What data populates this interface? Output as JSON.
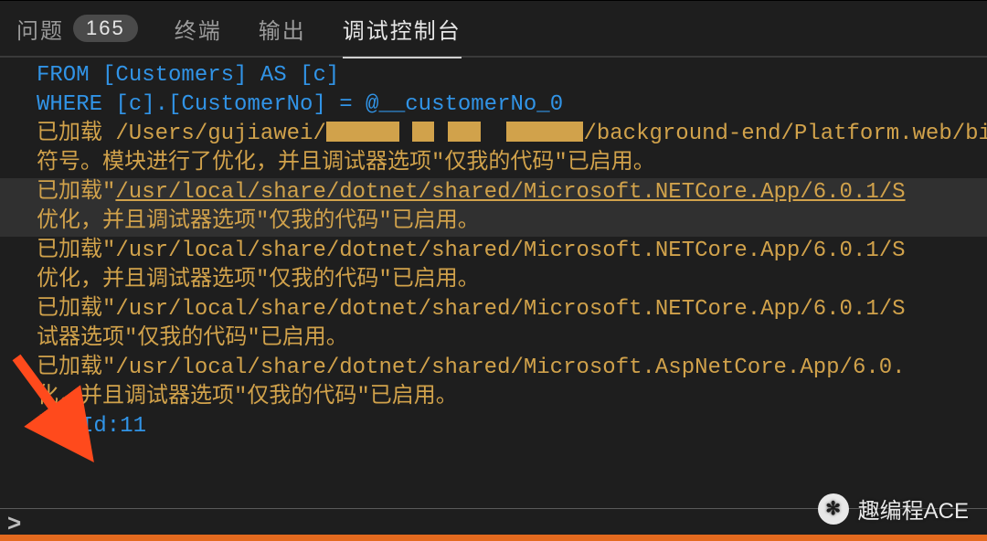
{
  "tabs": {
    "problems": {
      "label": "问题",
      "badge": "165"
    },
    "terminal": {
      "label": "终端"
    },
    "output": {
      "label": "输出"
    },
    "debug": {
      "label": "调试控制台"
    }
  },
  "console": {
    "sql_from": "FROM [Customers] AS [c]",
    "sql_where": "WHERE [c].[CustomerNo] = @__customerNo_0",
    "loaded_prefix": "已加载",
    "user_path_pre": " /Users/gujiawei/",
    "user_path_post": "/background-end/Platform.web/bi",
    "suffix_symbol": "符号。模块进行了优化，并且调试器选项\"仅我的代码\"已启用。",
    "path_netcore": "/usr/local/share/dotnet/shared/Microsoft.NETCore.App/6.0.1/S",
    "path_aspnet": "/usr/local/share/dotnet/shared/Microsoft.AspNetCore.App/6.0.",
    "opt_suffix": "优化，并且调试器选项\"仅我的代码\"已启用。",
    "opt_suffix_short": "试器选项\"仅我的代码\"已启用。",
    "opt_suffix_hua": "化，并且调试器选项\"仅我的代码\"已启用。",
    "quote_open": "\"",
    "user_id_label": "用户Id:11"
  },
  "prompt": ">",
  "watermark": {
    "text": "趣编程ACE"
  }
}
